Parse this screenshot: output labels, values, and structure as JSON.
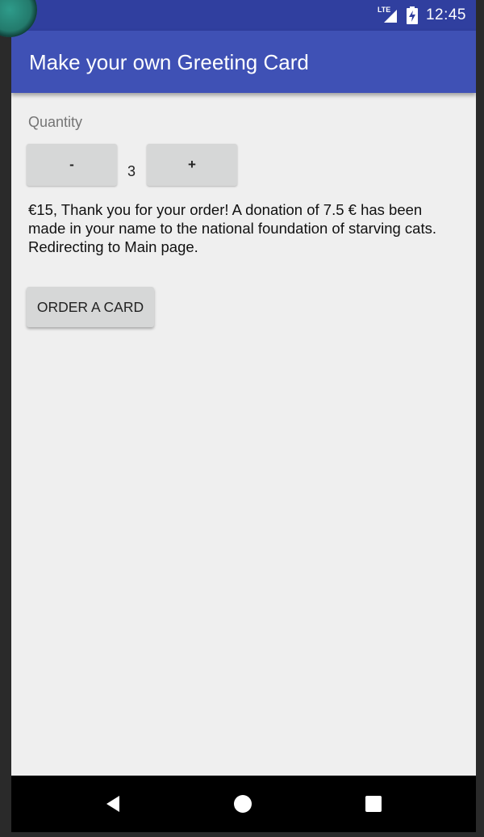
{
  "status_bar": {
    "network_label": "LTE",
    "time": "12:45",
    "icons": [
      "lte-signal-icon",
      "battery-charging-icon"
    ]
  },
  "app_bar": {
    "title": "Make your own Greeting Card"
  },
  "main": {
    "quantity_label": "Quantity",
    "decrement_label": "-",
    "quantity_value": "3",
    "increment_label": "+",
    "message_lines": [
      "€15, Thank you for your order! A donation of 7.5 € has been made in your name to the national foundation of starving cats.",
      "Redirecting to Main page."
    ],
    "order_button_label": "ORDER A CARD"
  },
  "nav_bar": {
    "icons": [
      "back-icon",
      "home-icon",
      "recents-icon"
    ]
  },
  "colors": {
    "status_bar": "#303f9f",
    "app_bar": "#3f51b5",
    "background": "#efefef",
    "button": "#d6d7d7",
    "nav_bar": "#000000"
  }
}
